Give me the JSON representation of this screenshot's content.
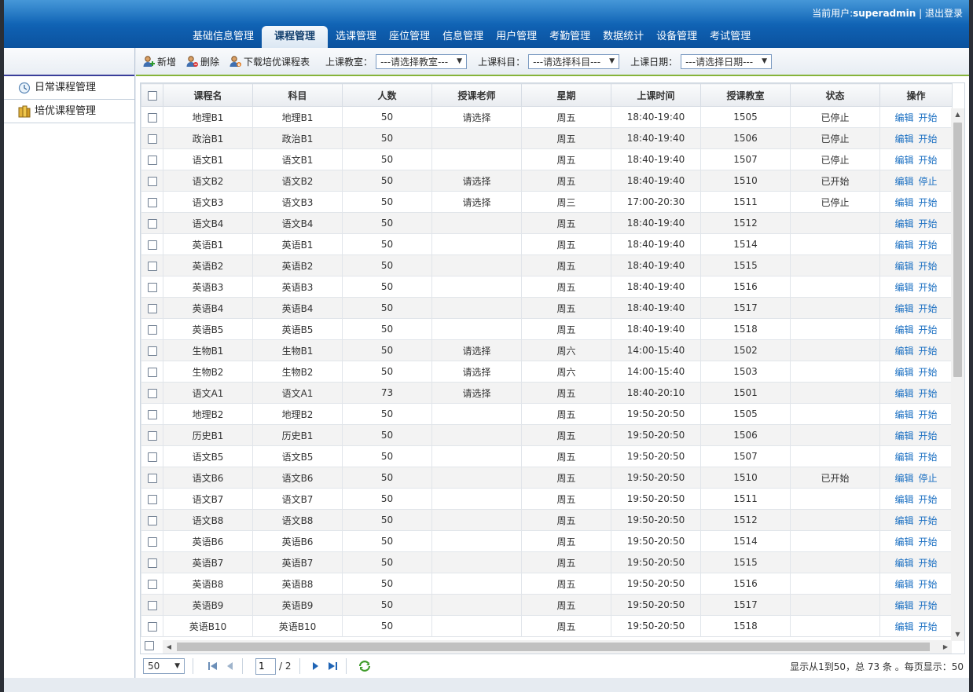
{
  "header": {
    "user_prefix": "当前用户:",
    "username": "superadmin",
    "divider": " | ",
    "logout": "退出登录"
  },
  "nav": [
    "基础信息管理",
    "课程管理",
    "选课管理",
    "座位管理",
    "信息管理",
    "用户管理",
    "考勤管理",
    "数据统计",
    "设备管理",
    "考试管理"
  ],
  "nav_active": "课程管理",
  "sidebar": {
    "items": [
      {
        "label": "日常课程管理",
        "icon": "clock-icon"
      },
      {
        "label": "培优课程管理",
        "icon": "books-icon"
      }
    ]
  },
  "toolbar": {
    "add": "新增",
    "delete": "删除",
    "download": "下载培优课程表",
    "classroom_label": "上课教室：",
    "classroom_value": "---请选择教室---",
    "subject_label": "上课科目：",
    "subject_value": "---请选择科目---",
    "date_label": "上课日期：",
    "date_value": "---请选择日期---"
  },
  "table": {
    "columns": [
      "课程名",
      "科目",
      "人数",
      "授课老师",
      "星期",
      "上课时间",
      "授课教室",
      "状态",
      "操作"
    ],
    "rows": [
      [
        "地理B1",
        "地理B1",
        "50",
        "请选择",
        "周五",
        "18:40-19:40",
        "1505",
        "已停止",
        "编辑",
        "开始"
      ],
      [
        "政治B1",
        "政治B1",
        "50",
        "",
        "周五",
        "18:40-19:40",
        "1506",
        "已停止",
        "编辑",
        "开始"
      ],
      [
        "语文B1",
        "语文B1",
        "50",
        "",
        "周五",
        "18:40-19:40",
        "1507",
        "已停止",
        "编辑",
        "开始"
      ],
      [
        "语文B2",
        "语文B2",
        "50",
        "请选择",
        "周五",
        "18:40-19:40",
        "1510",
        "已开始",
        "编辑",
        "停止"
      ],
      [
        "语文B3",
        "语文B3",
        "50",
        "请选择",
        "周三",
        "17:00-20:30",
        "1511",
        "已停止",
        "编辑",
        "开始"
      ],
      [
        "语文B4",
        "语文B4",
        "50",
        "",
        "周五",
        "18:40-19:40",
        "1512",
        "",
        "编辑",
        "开始"
      ],
      [
        "英语B1",
        "英语B1",
        "50",
        "",
        "周五",
        "18:40-19:40",
        "1514",
        "",
        "编辑",
        "开始"
      ],
      [
        "英语B2",
        "英语B2",
        "50",
        "",
        "周五",
        "18:40-19:40",
        "1515",
        "",
        "编辑",
        "开始"
      ],
      [
        "英语B3",
        "英语B3",
        "50",
        "",
        "周五",
        "18:40-19:40",
        "1516",
        "",
        "编辑",
        "开始"
      ],
      [
        "英语B4",
        "英语B4",
        "50",
        "",
        "周五",
        "18:40-19:40",
        "1517",
        "",
        "编辑",
        "开始"
      ],
      [
        "英语B5",
        "英语B5",
        "50",
        "",
        "周五",
        "18:40-19:40",
        "1518",
        "",
        "编辑",
        "开始"
      ],
      [
        "生物B1",
        "生物B1",
        "50",
        "请选择",
        "周六",
        "14:00-15:40",
        "1502",
        "",
        "编辑",
        "开始"
      ],
      [
        "生物B2",
        "生物B2",
        "50",
        "请选择",
        "周六",
        "14:00-15:40",
        "1503",
        "",
        "编辑",
        "开始"
      ],
      [
        "语文A1",
        "语文A1",
        "73",
        "请选择",
        "周五",
        "18:40-20:10",
        "1501",
        "",
        "编辑",
        "开始"
      ],
      [
        "地理B2",
        "地理B2",
        "50",
        "",
        "周五",
        "19:50-20:50",
        "1505",
        "",
        "编辑",
        "开始"
      ],
      [
        "历史B1",
        "历史B1",
        "50",
        "",
        "周五",
        "19:50-20:50",
        "1506",
        "",
        "编辑",
        "开始"
      ],
      [
        "语文B5",
        "语文B5",
        "50",
        "",
        "周五",
        "19:50-20:50",
        "1507",
        "",
        "编辑",
        "开始"
      ],
      [
        "语文B6",
        "语文B6",
        "50",
        "",
        "周五",
        "19:50-20:50",
        "1510",
        "已开始",
        "编辑",
        "停止"
      ],
      [
        "语文B7",
        "语文B7",
        "50",
        "",
        "周五",
        "19:50-20:50",
        "1511",
        "",
        "编辑",
        "开始"
      ],
      [
        "语文B8",
        "语文B8",
        "50",
        "",
        "周五",
        "19:50-20:50",
        "1512",
        "",
        "编辑",
        "开始"
      ],
      [
        "英语B6",
        "英语B6",
        "50",
        "",
        "周五",
        "19:50-20:50",
        "1514",
        "",
        "编辑",
        "开始"
      ],
      [
        "英语B7",
        "英语B7",
        "50",
        "",
        "周五",
        "19:50-20:50",
        "1515",
        "",
        "编辑",
        "开始"
      ],
      [
        "英语B8",
        "英语B8",
        "50",
        "",
        "周五",
        "19:50-20:50",
        "1516",
        "",
        "编辑",
        "开始"
      ],
      [
        "英语B9",
        "英语B9",
        "50",
        "",
        "周五",
        "19:50-20:50",
        "1517",
        "",
        "编辑",
        "开始"
      ],
      [
        "英语B10",
        "英语B10",
        "50",
        "",
        "周五",
        "19:50-20:50",
        "1518",
        "",
        "编辑",
        "开始"
      ]
    ]
  },
  "pager": {
    "page_size": "50",
    "current_page": "1",
    "total_pages": "/ 2",
    "info": "显示从1到50，总 73 条 。每页显示：50"
  },
  "colors": {
    "accent": "#1266b8",
    "status_red": "#e00000",
    "link": "#1a6fc2",
    "toolbar_line": "#86b43a"
  }
}
